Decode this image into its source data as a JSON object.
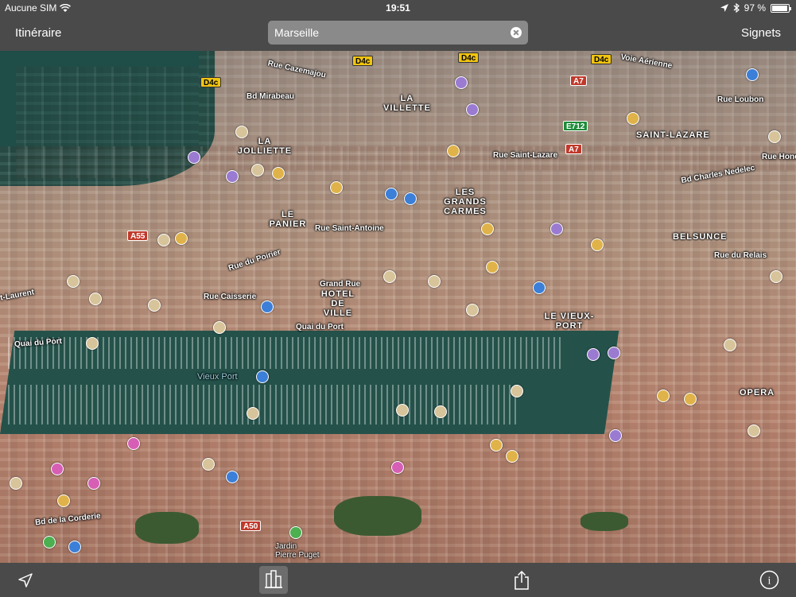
{
  "status_bar": {
    "carrier": "Aucune SIM",
    "time": "19:51",
    "battery_text": "97 %",
    "battery_level": 0.97
  },
  "nav_bar": {
    "left_button": "Itinéraire",
    "right_button": "Signets",
    "search_value": "Marseille"
  },
  "map": {
    "districts": [
      "LA JOLLIETTE",
      "LA VILLETTE",
      "SAINT-LAZARE",
      "LES GRANDS CARMES",
      "LE PANIER",
      "BELSUNCE",
      "HOTEL DE VILLE",
      "LE VIEUX-PORT",
      "OPERA"
    ],
    "streets": [
      "Rue Cazemajou",
      "Bd Mirabeau",
      "Voie Aérienne",
      "Rue Loubon",
      "Rue Saint-Lazare",
      "Bd Charles Nedelec",
      "Rue Hono",
      "Rue Saint-Antoine",
      "Rue du Poirier",
      "Rue du Relais",
      "Rue Caisserie",
      "Grand Rue",
      "Quai du Port",
      "Quai du Port",
      "t-Laurent",
      "Bd de la Corderie",
      "Jardin Pierre Puget"
    ],
    "water_label": "Vieux Port",
    "shields": {
      "d4c": "D4c",
      "a7": "A7",
      "e712": "E712",
      "a55": "A55",
      "a50": "A50"
    }
  },
  "toolbar": {
    "icons": [
      "location-arrow-icon",
      "buildings-3d-icon",
      "share-icon",
      "info-icon"
    ],
    "info_label": "i"
  }
}
